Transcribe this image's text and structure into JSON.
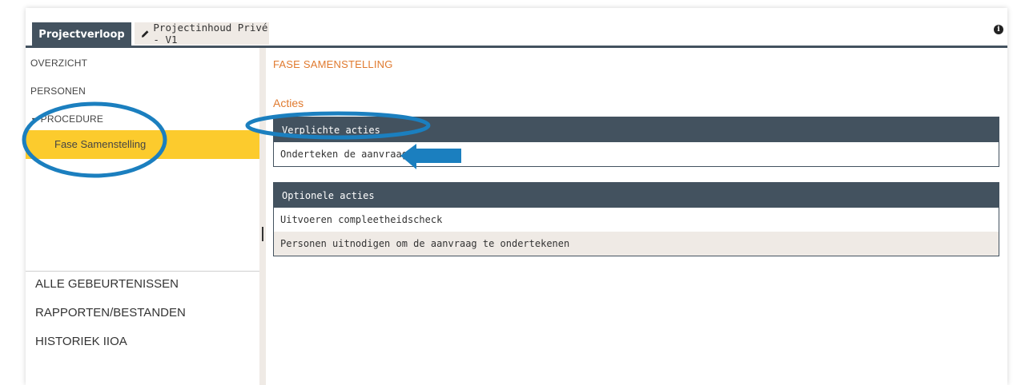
{
  "tabs": {
    "active": "Projectverloop",
    "inactive": "Projectinhoud Privé - V1"
  },
  "sidebar": {
    "items": [
      "OVERZICHT",
      "PERSONEN",
      "PROCEDURE"
    ],
    "expand_marker": "▼",
    "selected": "Fase Samenstelling",
    "links": [
      "ALLE GEBEURTENISSEN",
      "RAPPORTEN/BESTANDEN",
      "HISTORIEK IIOA"
    ]
  },
  "main": {
    "title": "FASE SAMENSTELLING",
    "section": "Acties",
    "required": {
      "header": "Verplichte acties",
      "rows": [
        "Onderteken de aanvraag"
      ]
    },
    "optional": {
      "header": "Optionele acties",
      "rows": [
        "Uitvoeren compleetheidscheck",
        "Personen uitnodigen om de aanvraag te ondertekenen"
      ]
    }
  },
  "icons": {
    "pencil": "pencil-icon",
    "info": "info-icon",
    "info_glyph": "i"
  },
  "colors": {
    "header_bg": "#43525f",
    "accent_orange": "#e07a2f",
    "selected_bg": "#fccb2d",
    "annotation_blue": "#1b7fbf"
  }
}
